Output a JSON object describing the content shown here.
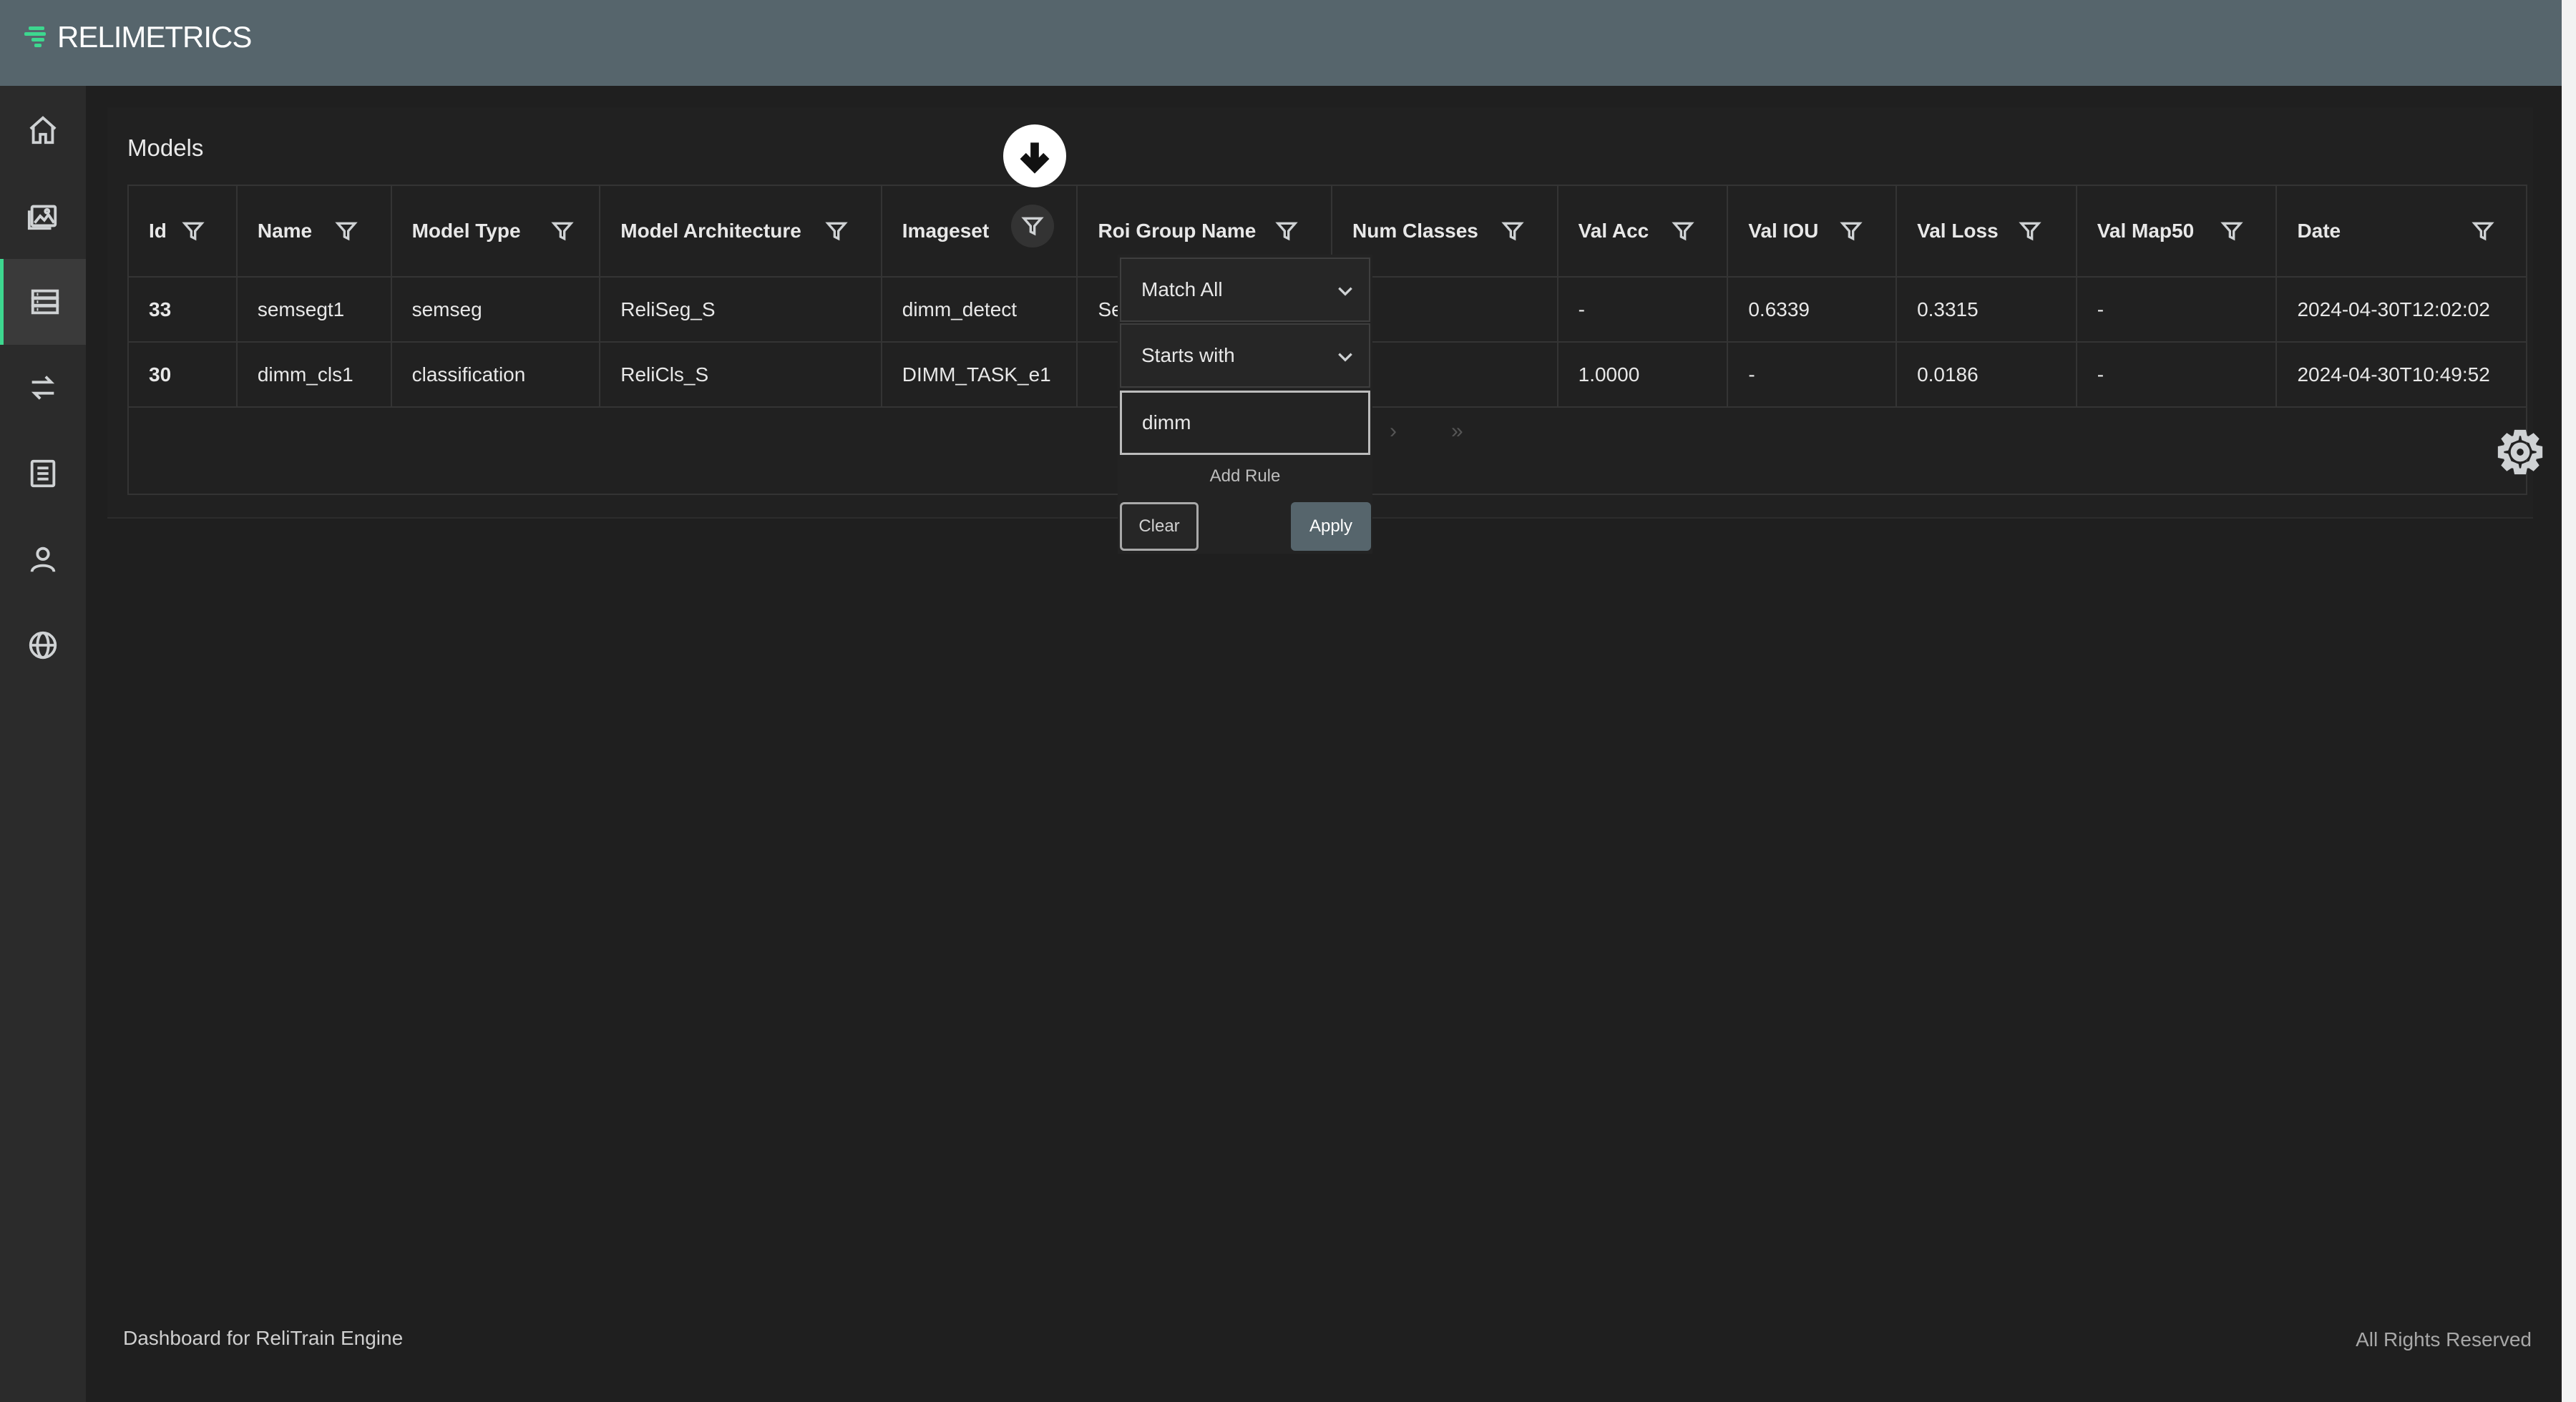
{
  "app": {
    "logo_text": "RELIMETRICS",
    "brand_color": "#3dd78f",
    "header_color": "#56656c"
  },
  "sidebar": {
    "items": [
      {
        "icon": "home-icon",
        "active": false
      },
      {
        "icon": "image-icon",
        "active": false
      },
      {
        "icon": "database-icon",
        "active": true
      },
      {
        "icon": "transfer-icon",
        "active": false
      },
      {
        "icon": "document-icon",
        "active": false
      },
      {
        "icon": "user-icon",
        "active": false
      },
      {
        "icon": "globe-icon",
        "active": false
      }
    ]
  },
  "page": {
    "title": "Models"
  },
  "table": {
    "columns": [
      "Id",
      "Name",
      "Model Type",
      "Model Architecture",
      "Imageset",
      "Roi Group Name",
      "Num Classes",
      "Val Acc",
      "Val IOU",
      "Val Loss",
      "Val Map50",
      "Date"
    ],
    "rows": [
      [
        "33",
        "semsegt1",
        "semseg",
        "ReliSeg_S",
        "dimm_detect",
        "Se",
        "",
        "-",
        "0.6339",
        "0.3315",
        "-",
        "2024-04-30T12:02:02"
      ],
      [
        "30",
        "dimm_cls1",
        "classification",
        "ReliCls_S",
        "DIMM_TASK_e1",
        "",
        "",
        "1.0000",
        "-",
        "0.0186",
        "-",
        "2024-04-30T10:49:52"
      ]
    ],
    "pager": {
      "next": "›",
      "last": "»"
    }
  },
  "filter_popup": {
    "match_mode": "Match All",
    "condition": "Starts with",
    "value": "dimm",
    "add_rule_label": "Add Rule",
    "clear_label": "Clear",
    "apply_label": "Apply"
  },
  "footer": {
    "left": "Dashboard for ReliTrain Engine",
    "right": "All Rights Reserved"
  }
}
